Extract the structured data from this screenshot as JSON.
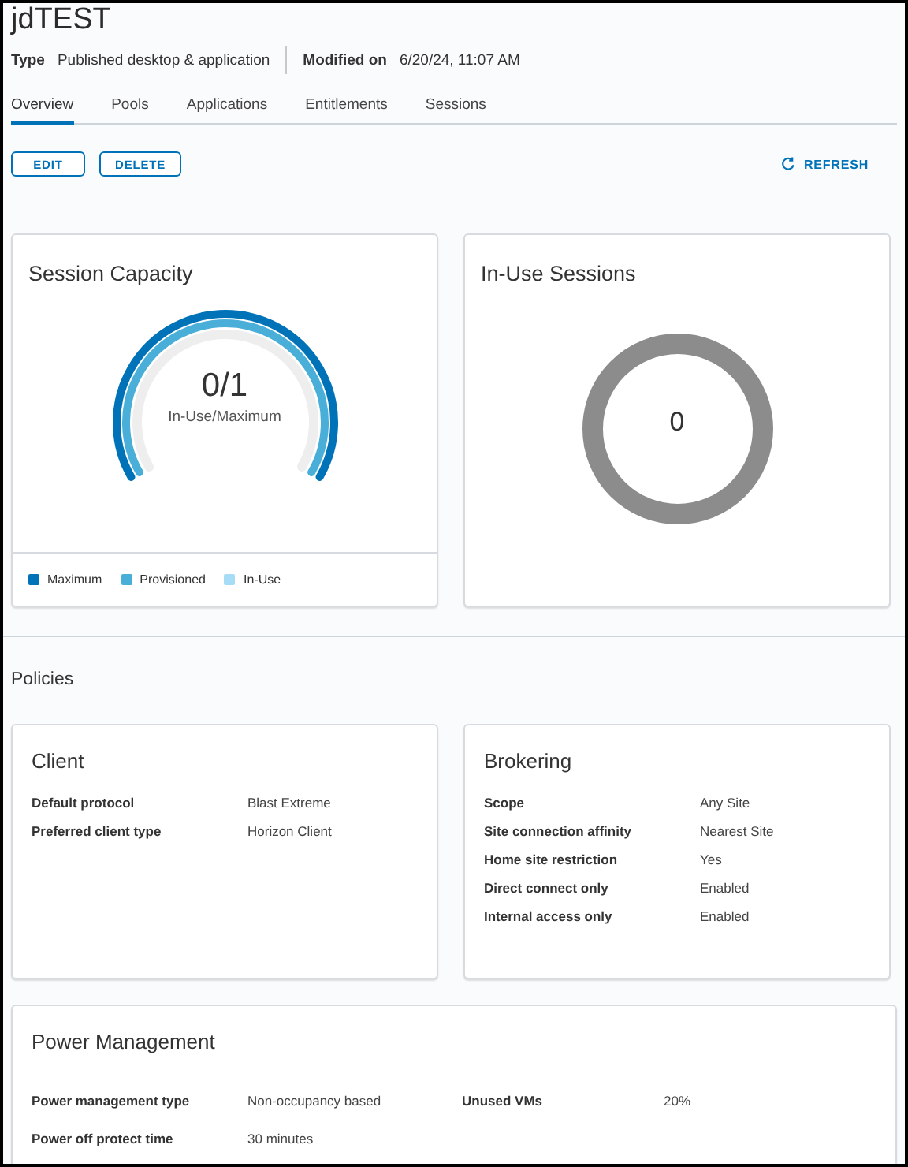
{
  "title": "jdTEST",
  "meta": [
    {
      "label": "Type",
      "value": "Published desktop & application"
    },
    {
      "label": "Modified on",
      "value": "6/20/24, 11:07 AM"
    }
  ],
  "tabs": [
    {
      "label": "Overview",
      "selected": true
    },
    {
      "label": "Pools",
      "selected": false
    },
    {
      "label": "Applications",
      "selected": false
    },
    {
      "label": "Entitlements",
      "selected": false
    },
    {
      "label": "Sessions",
      "selected": false
    }
  ],
  "actions": [
    "EDIT",
    "DELETE"
  ],
  "refresh": "REFRESH",
  "session_capacity": {
    "title": "Session Capacity",
    "value": "0/1",
    "caption": "In-Use/Maximum",
    "series": [
      {
        "name": "Maximum",
        "color": "#0072b8"
      },
      {
        "name": "Provisioned",
        "color": "#49afd9"
      },
      {
        "name": "In-Use",
        "color": "#a6dcf5"
      }
    ]
  },
  "in_use_sessions": {
    "title": "In-Use Sessions",
    "value": "0"
  },
  "policies_heading": "Policies",
  "client": {
    "title": "Client",
    "rows": [
      {
        "label": "Default protocol",
        "value": "Blast Extreme"
      },
      {
        "label": "Preferred client type",
        "value": "Horizon Client"
      }
    ]
  },
  "brokering": {
    "title": "Brokering",
    "rows": [
      {
        "label": "Scope",
        "value": "Any Site"
      },
      {
        "label": "Site connection affinity",
        "value": "Nearest Site"
      },
      {
        "label": "Home site restriction",
        "value": "Yes"
      },
      {
        "label": "Direct connect only",
        "value": "Enabled"
      },
      {
        "label": "Internal access only",
        "value": "Enabled"
      }
    ]
  },
  "power_management": {
    "title": "Power Management",
    "rows": [
      {
        "label": "Power management type",
        "value": "Non-occupancy based"
      },
      {
        "label": "Unused VMs",
        "value": "20%"
      },
      {
        "label": "Power off protect time",
        "value": "30 minutes"
      }
    ]
  }
}
